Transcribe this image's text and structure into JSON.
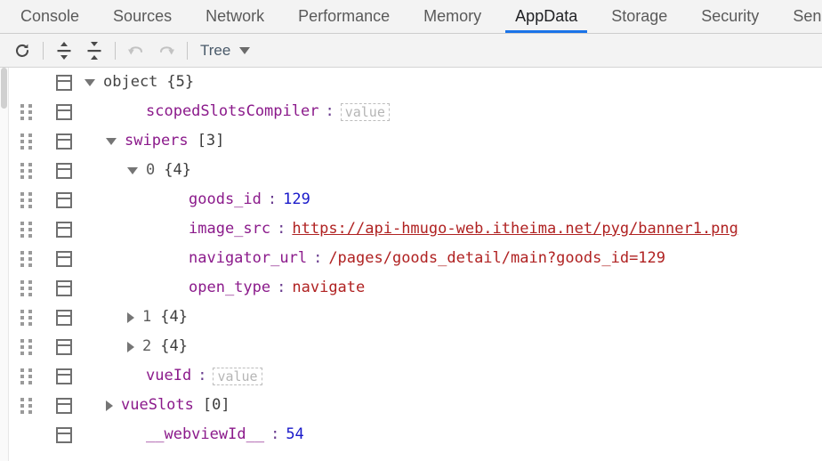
{
  "tabs": [
    {
      "label": "Console",
      "active": false
    },
    {
      "label": "Sources",
      "active": false
    },
    {
      "label": "Network",
      "active": false
    },
    {
      "label": "Performance",
      "active": false
    },
    {
      "label": "Memory",
      "active": false
    },
    {
      "label": "AppData",
      "active": true
    },
    {
      "label": "Storage",
      "active": false
    },
    {
      "label": "Security",
      "active": false
    },
    {
      "label": "Sensor",
      "active": false
    }
  ],
  "toolbar": {
    "refresh_icon": "refresh-icon",
    "expand_all_icon": "expand-all-icon",
    "collapse_all_icon": "collapse-all-icon",
    "undo_icon": "undo-icon",
    "redo_icon": "redo-icon",
    "view_mode_label": "Tree",
    "view_mode_caret": "chevron-down-icon"
  },
  "accent_color": "#1a73e8",
  "colors": {
    "key": "#8b1a8b",
    "number": "#1a1aca",
    "string": "#b02222",
    "root": "#444444",
    "placeholder": "#b5b5b5"
  },
  "tree": [
    {
      "indent": 0,
      "toggle": "down",
      "drag": false,
      "kind": "root",
      "key": "object",
      "count": "{5}"
    },
    {
      "indent": 2,
      "toggle": "none",
      "drag": true,
      "kind": "key-empty",
      "key": "scopedSlotsCompiler",
      "value": "value"
    },
    {
      "indent": 1,
      "toggle": "down",
      "drag": true,
      "kind": "key-count",
      "key": "swipers",
      "count": "[3]"
    },
    {
      "indent": 2,
      "toggle": "down",
      "drag": true,
      "kind": "index-count",
      "key": "0",
      "count": "{4}"
    },
    {
      "indent": 4,
      "toggle": "none",
      "drag": true,
      "kind": "key-number",
      "key": "goods_id",
      "value": "129"
    },
    {
      "indent": 4,
      "toggle": "none",
      "drag": true,
      "kind": "key-link",
      "key": "image_src",
      "value": "https://api-hmugo-web.itheima.net/pyg/banner1.png"
    },
    {
      "indent": 4,
      "toggle": "none",
      "drag": true,
      "kind": "key-string",
      "key": "navigator_url",
      "value": "/pages/goods_detail/main?goods_id=129"
    },
    {
      "indent": 4,
      "toggle": "none",
      "drag": true,
      "kind": "key-string",
      "key": "open_type",
      "value": "navigate"
    },
    {
      "indent": 2,
      "toggle": "right",
      "drag": true,
      "kind": "index-count",
      "key": "1",
      "count": "{4}"
    },
    {
      "indent": 2,
      "toggle": "right",
      "drag": true,
      "kind": "index-count",
      "key": "2",
      "count": "{4}"
    },
    {
      "indent": 2,
      "toggle": "none",
      "drag": true,
      "kind": "key-empty",
      "key": "vueId",
      "value": "value"
    },
    {
      "indent": 1,
      "toggle": "right",
      "drag": true,
      "kind": "key-count",
      "key": "vueSlots",
      "count": "[0]"
    },
    {
      "indent": 2,
      "toggle": "none",
      "drag": false,
      "kind": "key-number",
      "key": "__webviewId__",
      "value": "54"
    }
  ]
}
